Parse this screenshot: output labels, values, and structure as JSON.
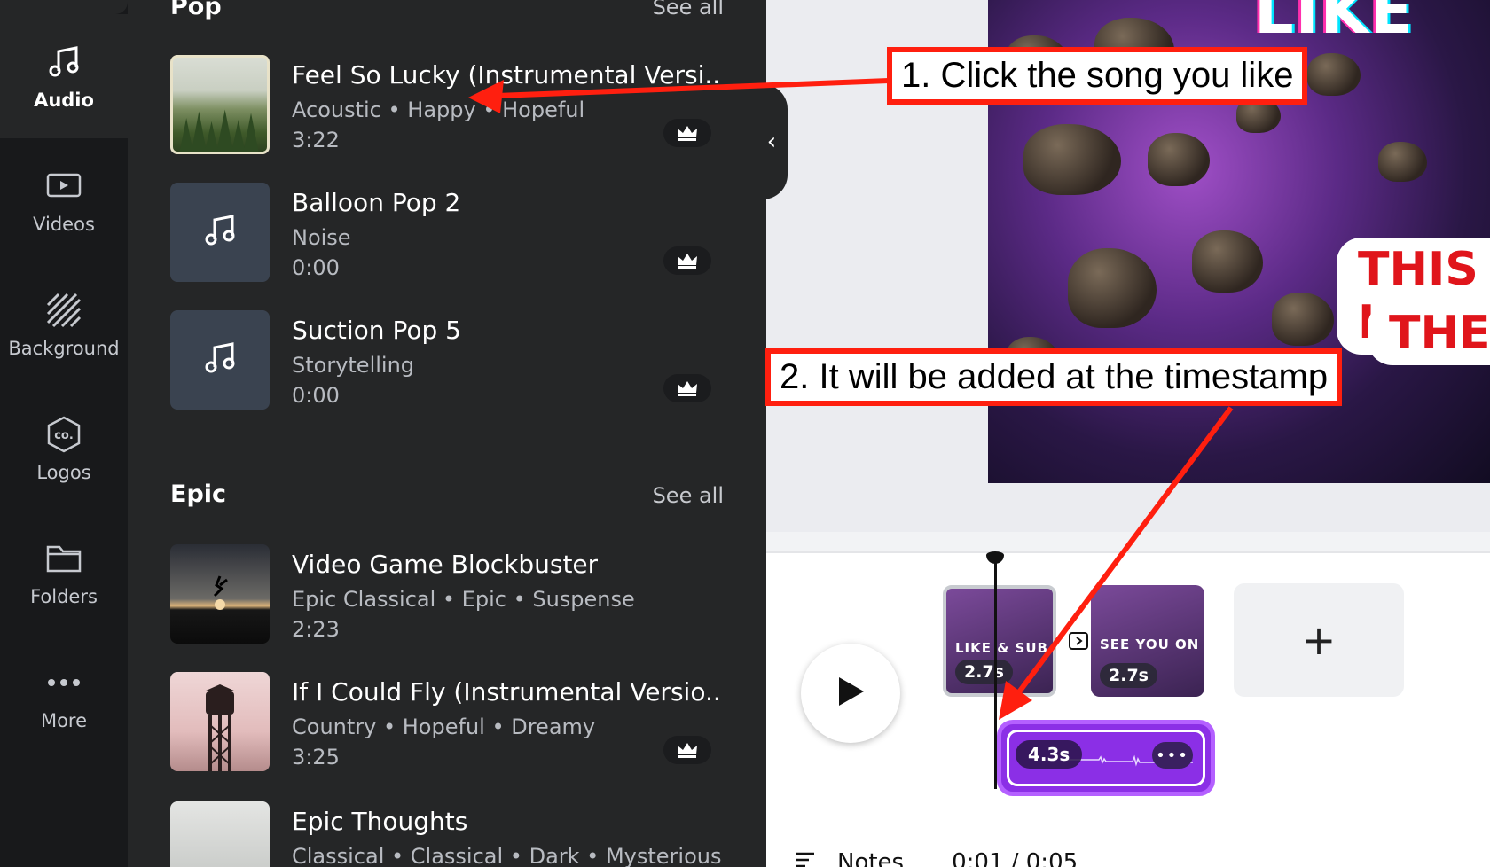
{
  "sidebar": {
    "items": [
      {
        "label": "Audio",
        "icon": "music-note-icon"
      },
      {
        "label": "Videos",
        "icon": "video-play-icon"
      },
      {
        "label": "Background",
        "icon": "background-stripes-icon"
      },
      {
        "label": "Logos",
        "icon": "logo-badge-icon"
      },
      {
        "label": "Folders",
        "icon": "folder-icon"
      },
      {
        "label": "More",
        "icon": "more-dots-icon"
      }
    ]
  },
  "panel": {
    "pop": {
      "title": "Pop",
      "see_all": "See all",
      "tracks": [
        {
          "title": "Feel So Lucky (Instrumental Versi..",
          "tags": "Acoustic • Happy • Hopeful",
          "duration": "3:22"
        },
        {
          "title": "Balloon Pop 2",
          "tags": "Noise",
          "duration": "0:00"
        },
        {
          "title": "Suction Pop 5",
          "tags": "Storytelling",
          "duration": "0:00"
        }
      ]
    },
    "epic": {
      "title": "Epic",
      "see_all": "See all",
      "tracks": [
        {
          "title": "Video Game Blockbuster",
          "tags": "Epic Classical • Epic • Suspense",
          "duration": "2:23"
        },
        {
          "title": "If I Could Fly (Instrumental Versio..",
          "tags": "Country • Hopeful • Dreamy",
          "duration": "3:25"
        },
        {
          "title": "Epic Thoughts",
          "tags": "Classical • Classical • Dark • Mysterious",
          "duration": ""
        }
      ]
    }
  },
  "canvas": {
    "like_text": "LIKE",
    "bubble_line1": "THIS I",
    "bubble_line2": "THE"
  },
  "timeline": {
    "clips": [
      {
        "duration": "2.7s",
        "text": "LIKE & SUB"
      },
      {
        "duration": "2.7s",
        "text": "SEE YOU ON NEXT VII"
      }
    ],
    "audio_duration": "4.3s",
    "audio_more": "•••",
    "add_label": "+",
    "notes_label": "Notes",
    "time_readout": "0:01 / 0:05"
  },
  "annotations": {
    "callout1": "1. Click the song you like",
    "callout2": "2. It will be added at the timestamp"
  },
  "colors": {
    "accent_red": "#ff1f0f",
    "audio_purple": "#8b2fe6",
    "panel_bg": "#252627",
    "rail_bg": "#18191b"
  }
}
